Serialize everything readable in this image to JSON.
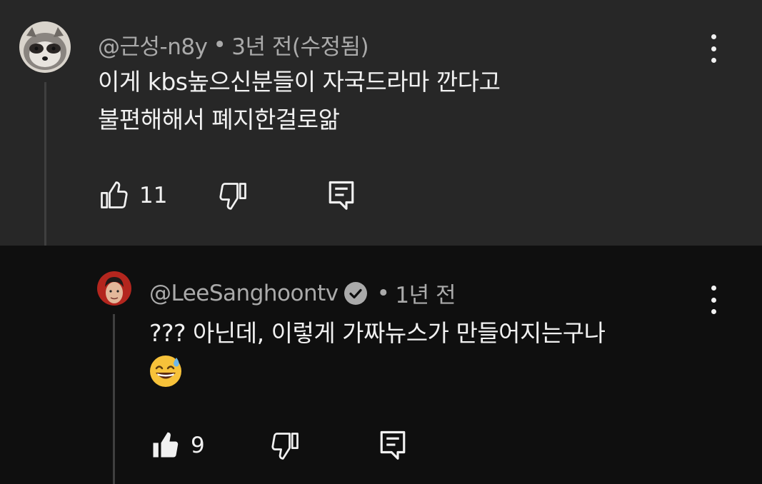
{
  "comment": {
    "author": "@근성-n8y",
    "separator": "•",
    "time": "3년 전(수정됨)",
    "lines": [
      "이게 kbs높으신분들이 자국드라마 깐다고",
      "불편해해서 폐지한걸로앎"
    ],
    "like_count": "11",
    "avatar_icon": "raccoon-avatar"
  },
  "reply": {
    "author": "@LeeSanghoontv",
    "separator": "•",
    "time": "1년 전",
    "lines": [
      "??? 아닌데, 이렇게 가짜뉴스가 만들어지는구나"
    ],
    "emoji": "😅",
    "like_count": "9",
    "verified_icon": "verified-check-icon"
  },
  "colors": {
    "top_bg": "#272727",
    "reply_bg": "#0f0f0f",
    "meta": "#aaaaaa",
    "text": "#f1f1f1"
  }
}
